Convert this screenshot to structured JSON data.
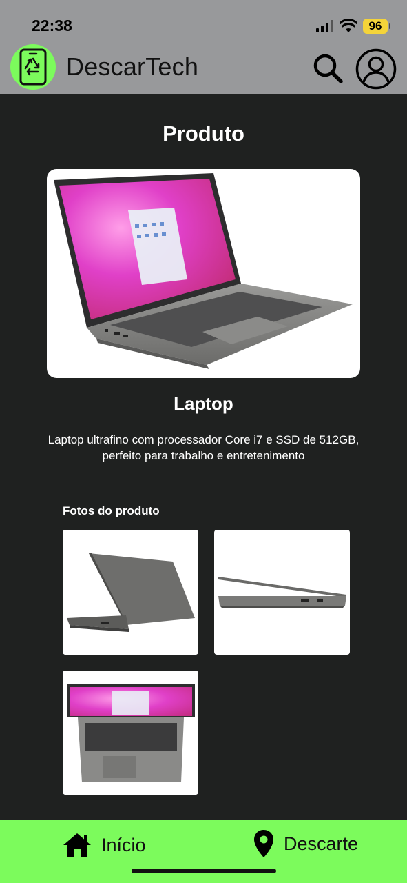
{
  "status_bar": {
    "time": "22:38",
    "battery": "96",
    "battery_color": "#f4d43a"
  },
  "header": {
    "app_title": "DescarTech",
    "logo_icon": "recycle-phone-icon",
    "search_icon": "search-icon",
    "profile_icon": "user-circle-icon",
    "background_color": "#98999b",
    "accent_color": "#7cfb5c"
  },
  "main": {
    "page_title": "Produto",
    "product_name": "Laptop",
    "product_description_line1": "Laptop ultrafino com processador Core i7 e SSD de 512GB,",
    "product_description_line2": "perfeito para trabalho e entretenimento",
    "photos_title": "Fotos do produto",
    "background_color": "#1f2120"
  },
  "bottom_nav": {
    "items": [
      {
        "label": "Início",
        "icon": "home-icon"
      },
      {
        "label": "Descarte",
        "icon": "map-pin-icon"
      }
    ],
    "background_color": "#7cfb5c"
  }
}
